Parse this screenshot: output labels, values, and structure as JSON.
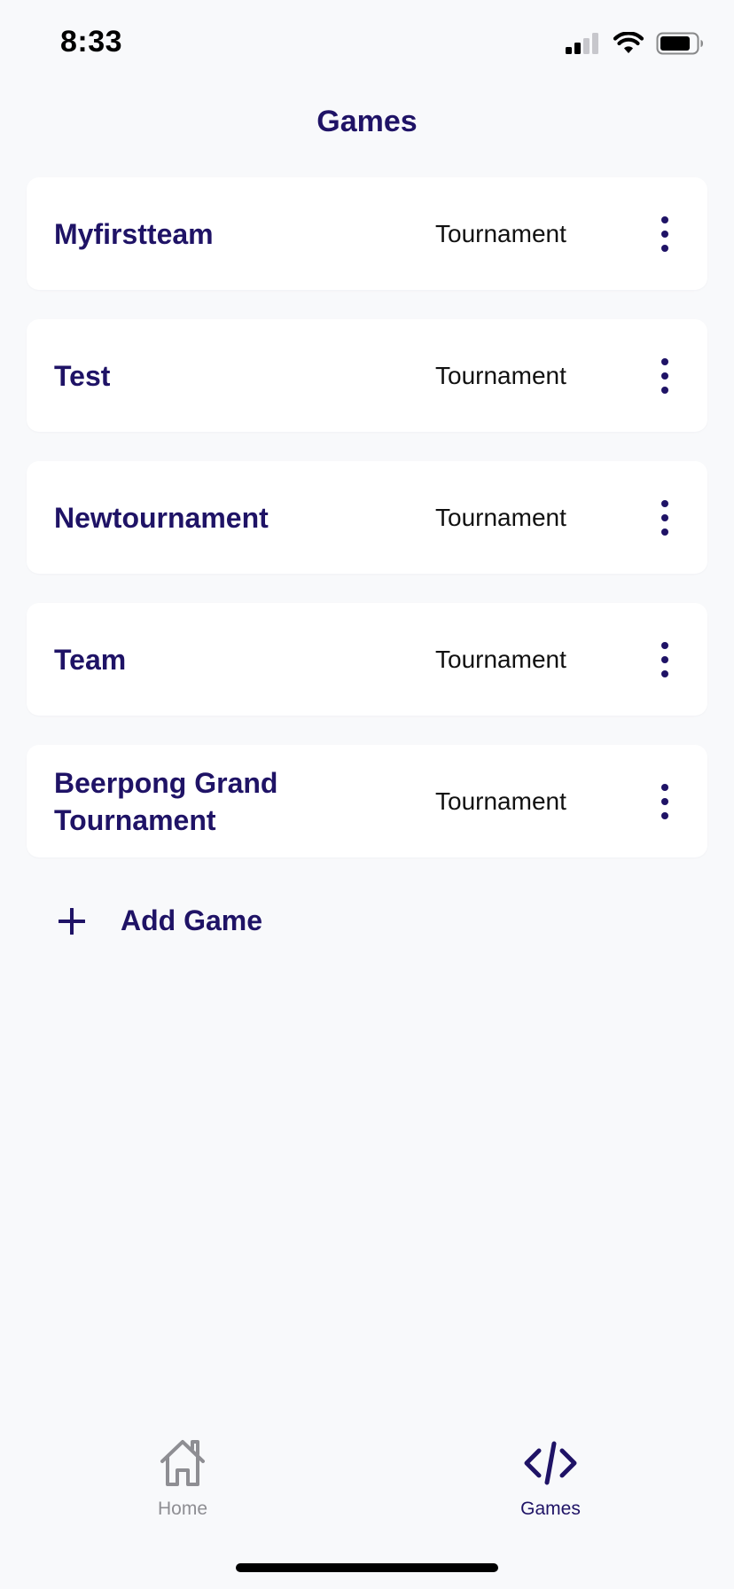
{
  "status_bar": {
    "time": "8:33",
    "icons": [
      "cellular-signal-icon",
      "wifi-icon",
      "battery-icon"
    ]
  },
  "header": {
    "title": "Games"
  },
  "games": [
    {
      "name": "Myfirstteam",
      "type": "Tournament",
      "menu_icon": "more-vertical-icon"
    },
    {
      "name": "Test",
      "type": "Tournament",
      "menu_icon": "more-vertical-icon"
    },
    {
      "name": "Newtournament",
      "type": "Tournament",
      "menu_icon": "more-vertical-icon"
    },
    {
      "name": "Team",
      "type": "Tournament",
      "menu_icon": "more-vertical-icon"
    },
    {
      "name": "Beerpong Grand Tournament",
      "type": "Tournament",
      "menu_icon": "more-vertical-icon"
    }
  ],
  "add_game": {
    "icon": "plus-icon",
    "label": "Add Game"
  },
  "tab_bar": {
    "tabs": [
      {
        "label": "Home",
        "icon": "home-icon",
        "active": false
      },
      {
        "label": "Games",
        "icon": "code-icon",
        "active": true
      }
    ]
  },
  "colors": {
    "accent": "#1f1366",
    "background": "#f8f9fb",
    "card": "#ffffff",
    "inactive_tab": "#8e8e93"
  }
}
